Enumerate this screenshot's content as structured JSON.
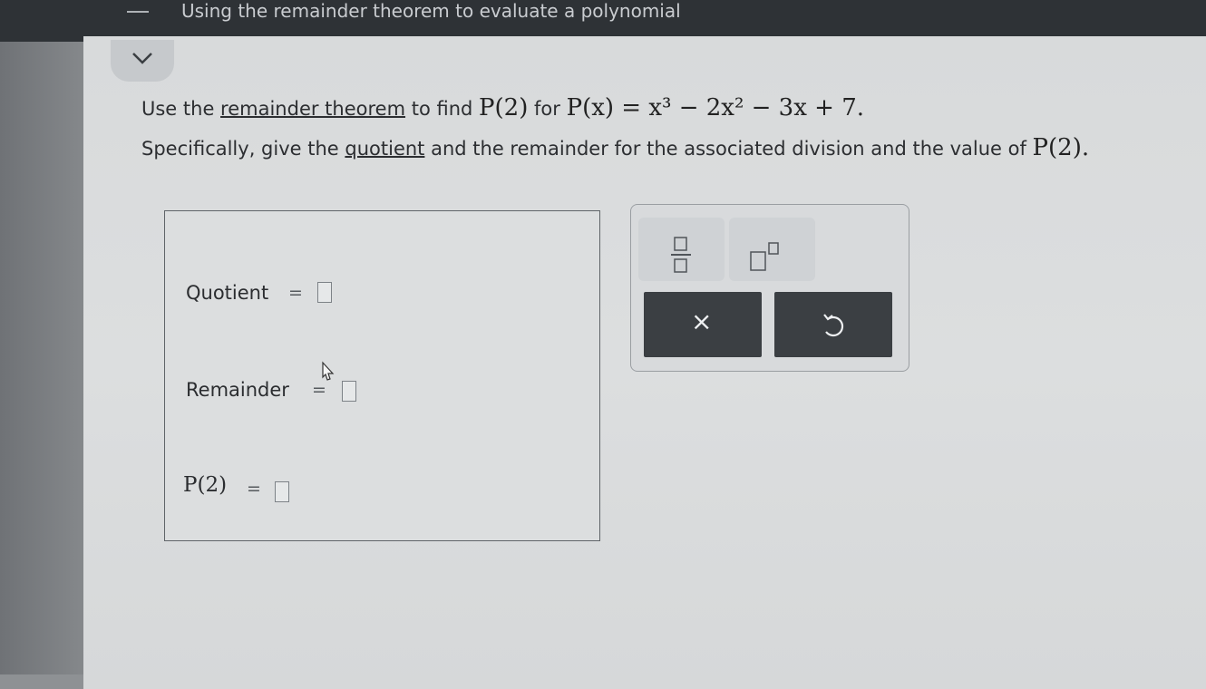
{
  "header": {
    "title": "Using the remainder theorem to evaluate a polynomial"
  },
  "icons": {
    "collapse": "chevron-down-icon",
    "fraction": "fraction-template-icon",
    "exponent": "exponent-template-icon",
    "clear": "clear-icon",
    "undo": "undo-icon"
  },
  "question": {
    "line1": {
      "part1": "Use the ",
      "link": "remainder theorem",
      "part2": " to find ",
      "value": "P(2)",
      "part3": " for ",
      "polynomial": "P(x) = x³ − 2x² − 3x + 7."
    },
    "line2": {
      "part1": "Specifically, give the ",
      "link": "quotient",
      "part2": " and the remainder for the associated division and the value of ",
      "value": "P(2)."
    }
  },
  "answers": {
    "quotient_label": "Quotient",
    "quotient_value": "",
    "remainder_label": "Remainder",
    "remainder_value": "",
    "p2_label": "P(2)",
    "p2_value": "",
    "equals": "="
  },
  "toolbar": {
    "clear_label": "×"
  }
}
